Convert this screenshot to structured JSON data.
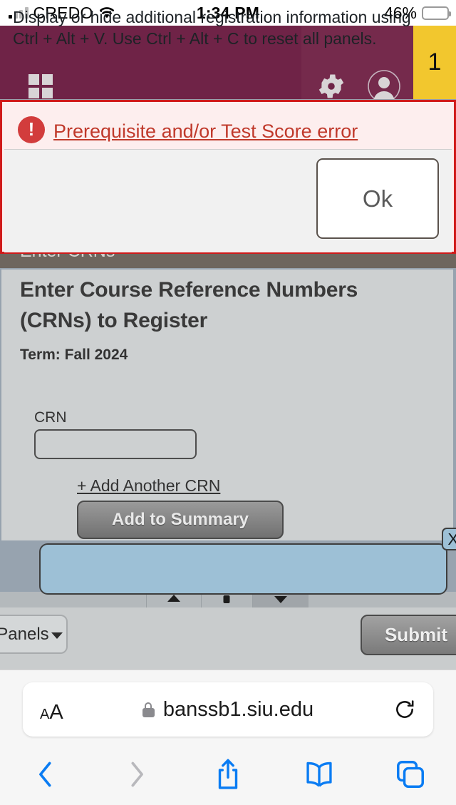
{
  "status_bar": {
    "carrier": "CREDO",
    "time": "1:34 PM",
    "battery_percent": "46%",
    "signal_icon": "cellular-signal-icon",
    "wifi_icon": "wifi-icon",
    "battery_icon": "battery-icon",
    "battery_color": "#F6C500"
  },
  "app_header": {
    "menu_icon": "grid-menu-icon",
    "settings_icon": "gear-icon",
    "profile_icon": "avatar-icon",
    "badge_count": "1",
    "bg_color": "#6f2347",
    "badge_color": "#F2C72E"
  },
  "error_dialog": {
    "icon": "error-exclamation-icon",
    "message": "Prerequisite and/or Test Score error",
    "ok_label": "Ok",
    "border_color": "#d01a1a",
    "message_color": "#c0392b"
  },
  "page": {
    "tab_label": "Enter CRNs",
    "title": "Enter Course Reference Numbers (CRNs) to Register",
    "term": "Term: Fall 2024",
    "crn_label": "CRN",
    "crn_value": "",
    "crn_placeholder": "",
    "add_another_label": "+ Add Another CRN",
    "add_to_summary_label": "Add to Summary"
  },
  "tooltip": {
    "text": "Display or hide additional registration information using Ctrl + Alt + V. Use Ctrl + Alt + C to reset all panels.",
    "close_label": "X",
    "bg_color": "#9dc0d6"
  },
  "splitter": {
    "up_icon": "triangle-up-icon",
    "handle_icon": "splitter-handle-icon",
    "down_icon": "triangle-down-icon"
  },
  "action_bar": {
    "panels_label": "Panels",
    "panels_caret": "chevron-down-icon",
    "submit_label": "Submit"
  },
  "safari": {
    "text_size_small": "A",
    "text_size_large": "A",
    "lock_icon": "lock-icon",
    "url": "banssb1.siu.edu",
    "reload_icon": "reload-icon",
    "back_icon": "chevron-left-icon",
    "forward_icon": "chevron-right-icon",
    "share_icon": "share-icon",
    "bookmarks_icon": "book-icon",
    "tabs_icon": "tabs-icon",
    "accent_color": "#0a7cf3"
  }
}
